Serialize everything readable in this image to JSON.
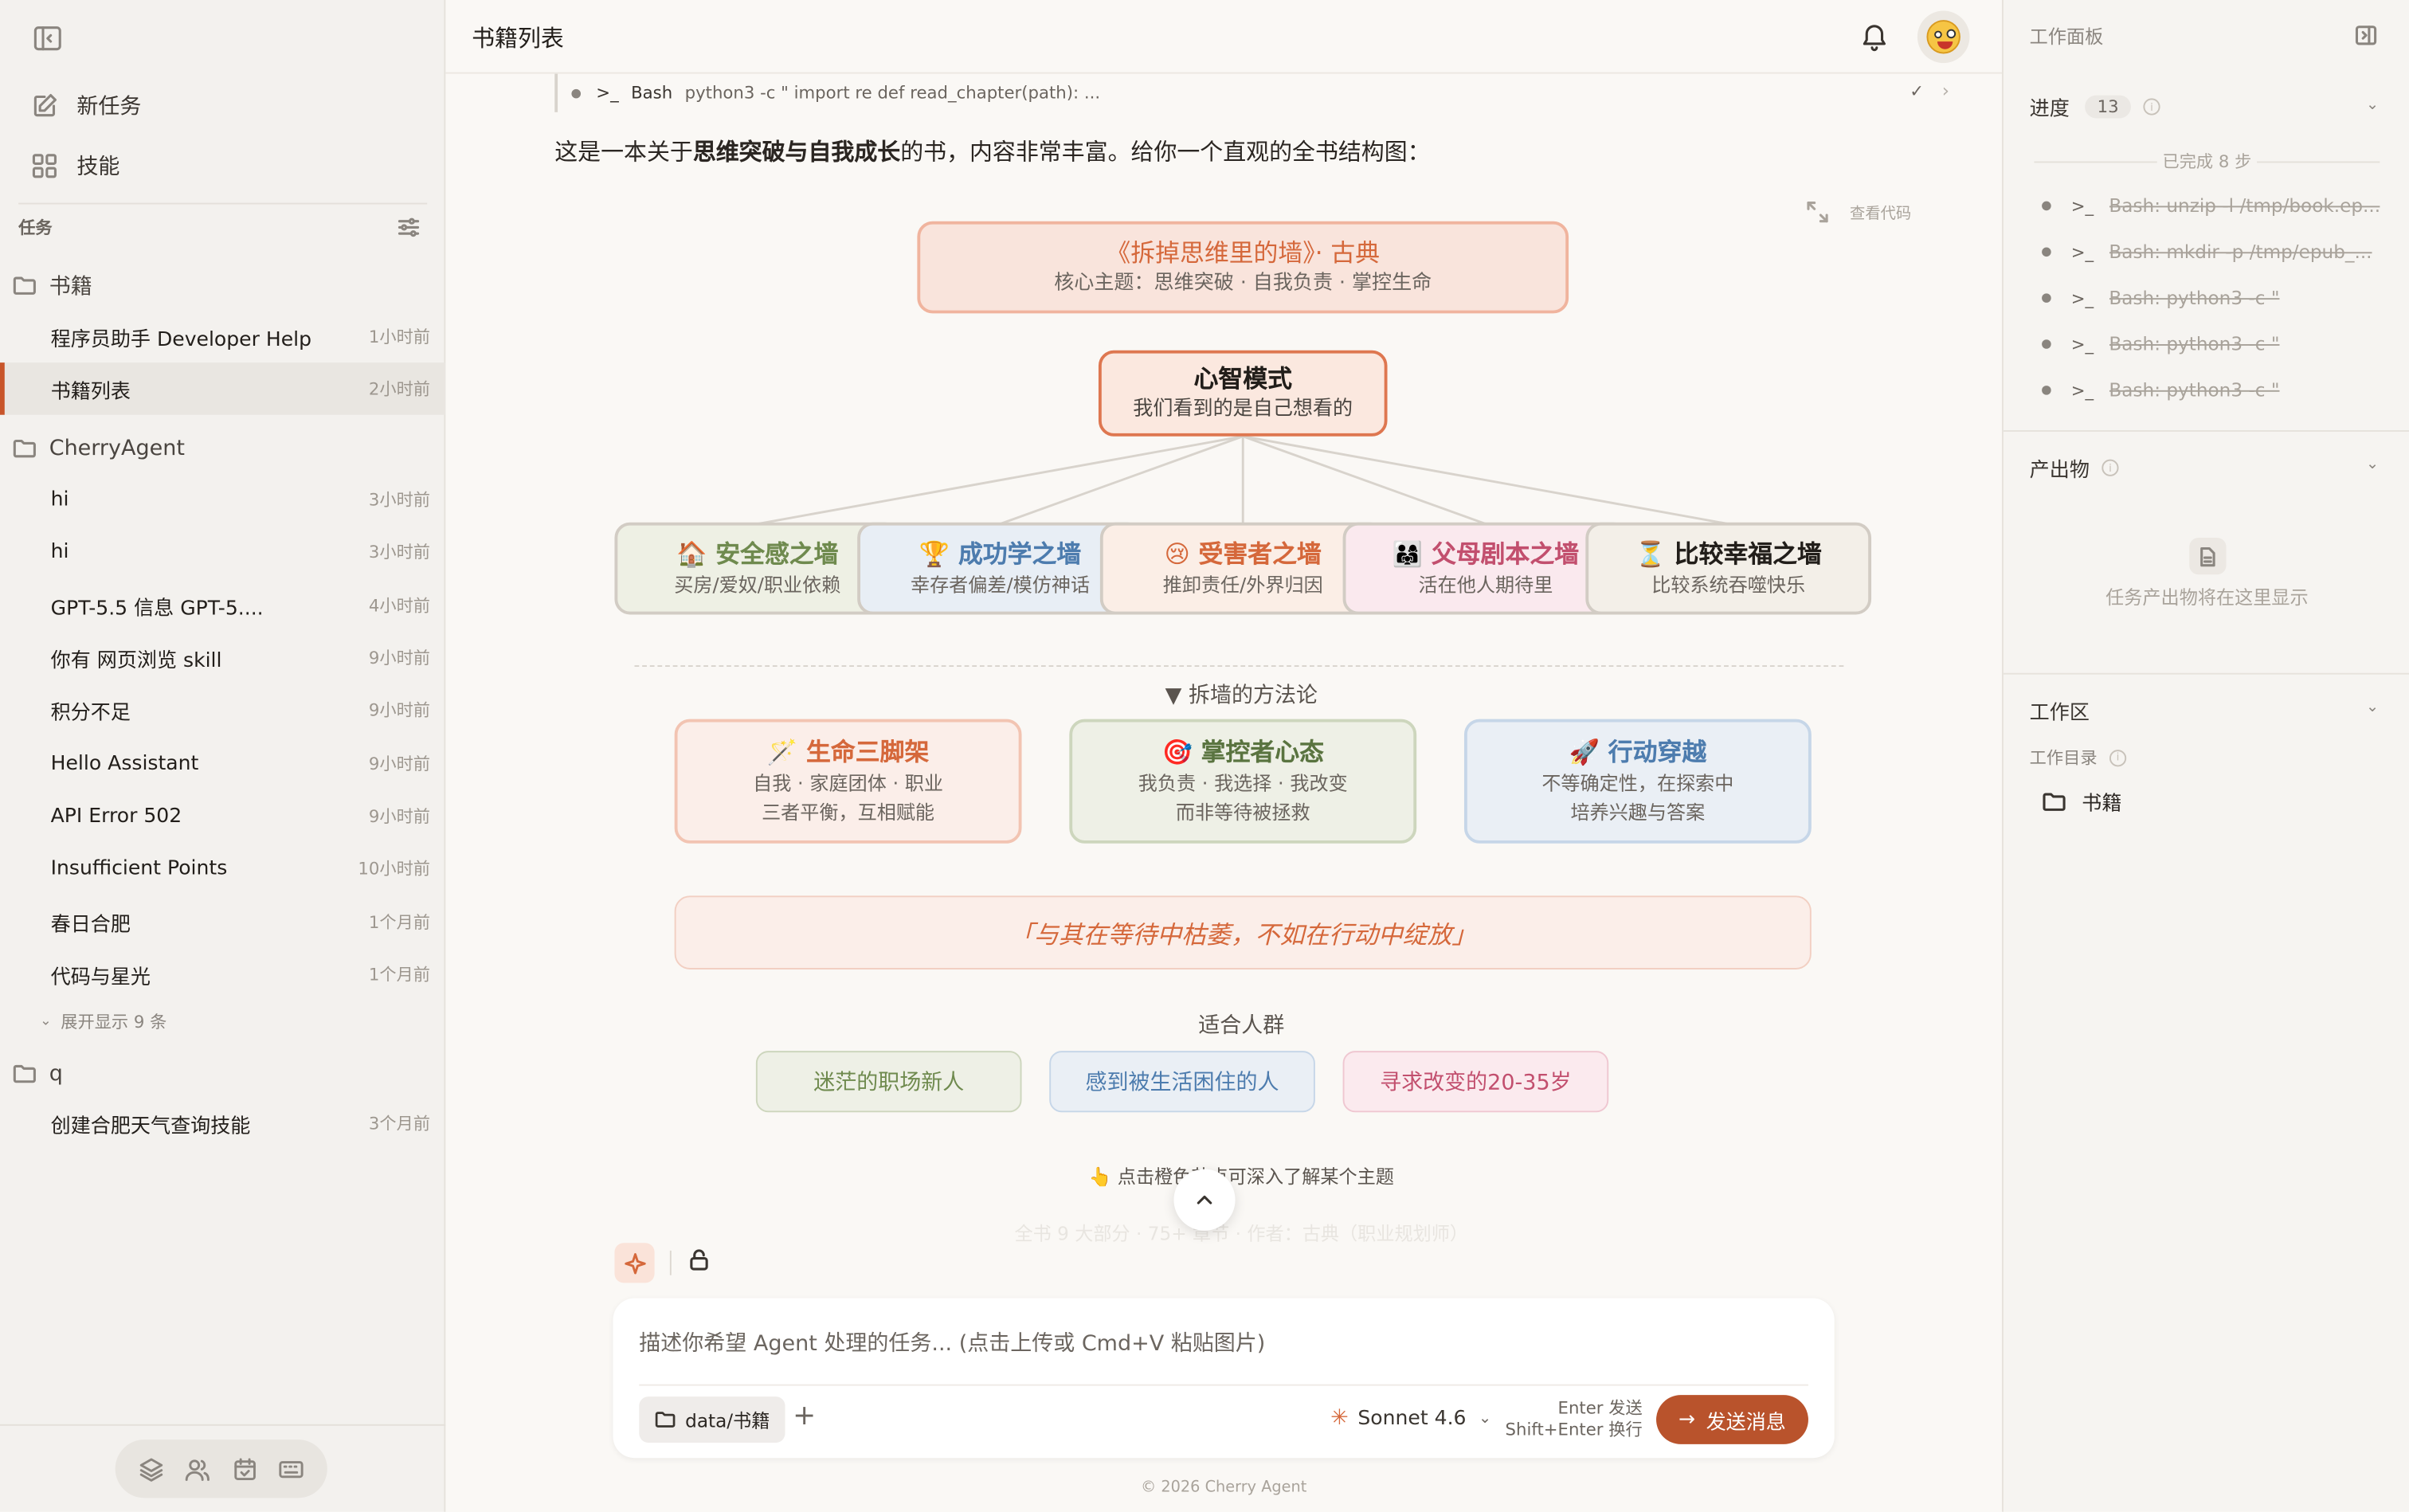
{
  "sidebar": {
    "new_task": "新任务",
    "skills": "技能",
    "section": "任务",
    "folders": [
      {
        "name": "书籍",
        "tasks": [
          {
            "title": "程序员助手 Developer Help",
            "time": "1小时前"
          },
          {
            "title": "书籍列表",
            "time": "2小时前"
          }
        ]
      },
      {
        "name": "CherryAgent",
        "tasks": [
          {
            "title": "hi",
            "time": "3小时前"
          },
          {
            "title": "hi",
            "time": "3小时前"
          },
          {
            "title": "GPT-5.5 信息 GPT-5....",
            "time": "4小时前"
          },
          {
            "title": "你有 网页浏览 skill",
            "time": "9小时前"
          },
          {
            "title": "积分不足",
            "time": "9小时前"
          },
          {
            "title": "Hello Assistant",
            "time": "9小时前"
          },
          {
            "title": "API Error 502",
            "time": "9小时前"
          },
          {
            "title": "Insufficient Points",
            "time": "10小时前"
          },
          {
            "title": "春日合肥",
            "time": "1个月前"
          },
          {
            "title": "代码与星光",
            "time": "1个月前"
          }
        ]
      },
      {
        "name": "q",
        "tasks": [
          {
            "title": "创建合肥天气查询技能",
            "time": "3个月前"
          }
        ]
      }
    ],
    "expand_label": "展开显示 9 条"
  },
  "header": {
    "title": "书籍列表"
  },
  "chat": {
    "tool_call": {
      "tool": "Bash",
      "command": "python3 -c \" import re def read_chapter(path): ..."
    },
    "intro_before": "这是一本关于",
    "intro_bold": "思维突破与自我成长",
    "intro_after": "的书，内容非常丰富。给你一个直观的全书结构图：",
    "view_code": "查看代码",
    "diagram": {
      "title": "《拆掉思维里的墙》· 古典",
      "subtitle": "核心主题：思维突破 · 自我负责 · 掌控生命",
      "core_title": "心智模式",
      "core_subtitle": "我们看到的是自己想看的",
      "walls": [
        {
          "title": "🏠 安全感之墙",
          "sub": "买房/爱奴/职业依赖",
          "color": "#6f8a4e"
        },
        {
          "title": "🏆 成功学之墙",
          "sub": "幸存者偏差/模仿神话",
          "color": "#4d7cae"
        },
        {
          "title": "😢 受害者之墙",
          "sub": "推卸责任/外界归因",
          "color": "#d5683b"
        },
        {
          "title": "👨‍👩‍👧 父母剧本之墙",
          "sub": "活在他人期待里",
          "color": "#c24f6e"
        },
        {
          "title": "⏳ 比较幸福之墙",
          "sub": "比较系统吞噬快乐",
          "color": "#221e1a"
        }
      ],
      "method_title": "▼ 拆墙的方法论",
      "methods": [
        {
          "title": "🪄 生命三脚架",
          "line1": "自我 · 家庭团体 · 职业",
          "line2": "三者平衡，互相赋能",
          "color": "#d5683b"
        },
        {
          "title": "🎯 掌控者心态",
          "line1": "我负责 · 我选择 · 我改变",
          "line2": "而非等待被拯救",
          "color": "#5a7440"
        },
        {
          "title": "🚀 行动穿越",
          "line1": "不等确定性，在探索中",
          "line2": "培养兴趣与答案",
          "color": "#4d7cae"
        }
      ],
      "quote": "「与其在等待中枯萎，不如在行动中绽放」",
      "audience_title": "适合人群",
      "audiences": [
        {
          "label": "迷茫的职场新人",
          "color": "#6f8a4e"
        },
        {
          "label": "感到被生活困住的人",
          "color": "#4d7cae"
        },
        {
          "label": "寻求改变的20-35岁",
          "color": "#c24f6e"
        }
      ],
      "hint": "👆 点击橙色节点可深入了解某个主题",
      "faded": "全书 9 大部分 · 75+ 章节 · 作者：古典（职业规划师）"
    }
  },
  "composer": {
    "placeholder": "描述你希望 Agent 处理的任务... (点击上传或 Cmd+V 粘贴图片)",
    "folder": "data/书籍",
    "model": "Sonnet 4.6",
    "keys_line1": "Enter 发送",
    "keys_line2": "Shift+Enter 换行",
    "send": "发送消息"
  },
  "footer": {
    "copyright": "© 2026 Cherry Agent"
  },
  "right_panel": {
    "title": "工作面板",
    "progress_label": "进度",
    "progress_count": "13",
    "completed": "已完成 8 步",
    "steps": [
      "Bash: unzip -l /tmp/book.ep...",
      "Bash: mkdir -p /tmp/epub_...",
      "Bash: python3 -c \"",
      "Bash: python3 -c \"",
      "Bash: python3 -c \""
    ],
    "artifacts_label": "产出物",
    "artifacts_empty": "任务产出物将在这里显示",
    "workspace_label": "工作区",
    "workdir_label": "工作目录",
    "workdir_folder": "书籍"
  }
}
